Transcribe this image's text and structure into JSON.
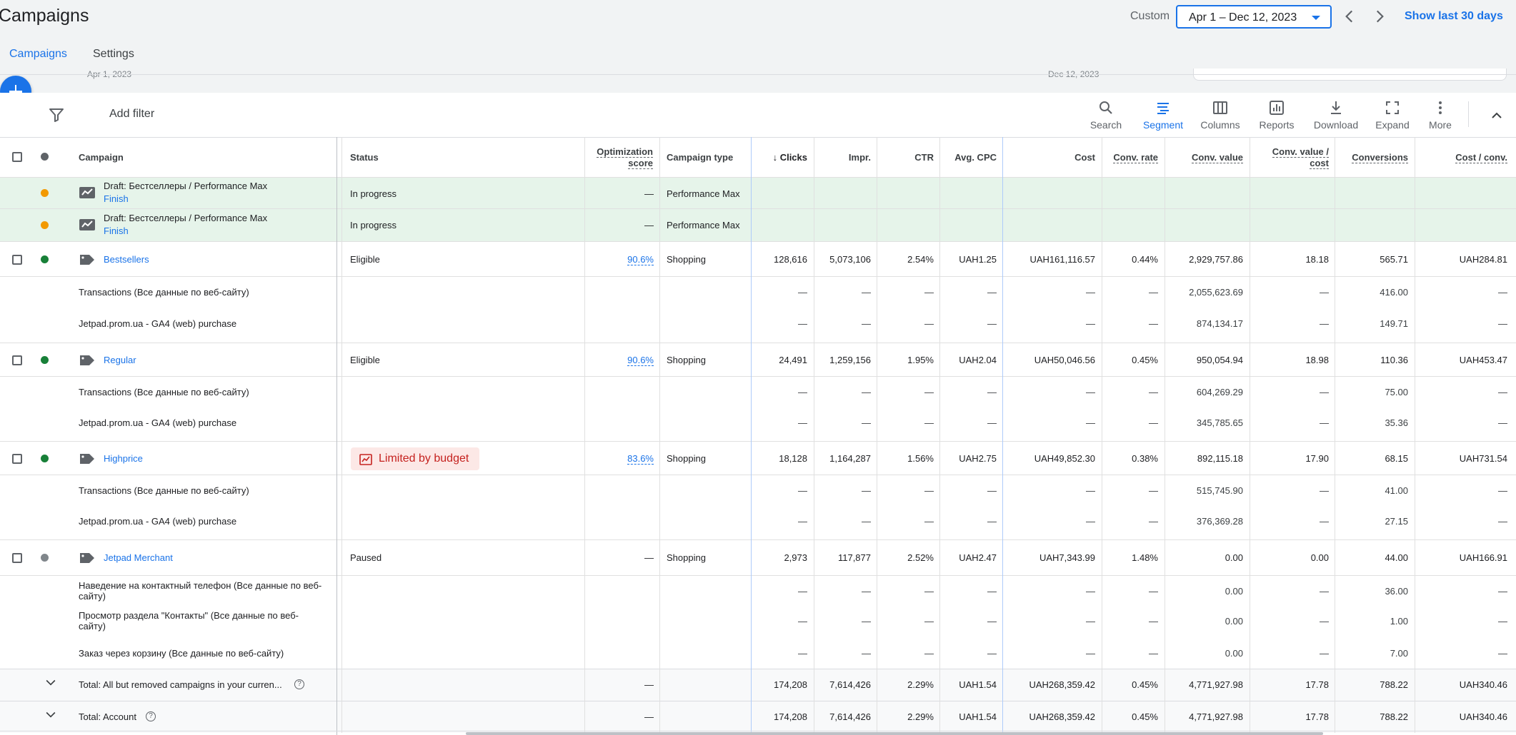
{
  "header": {
    "title": "Campaigns",
    "date_label": "Custom",
    "date_range": "Apr 1 – Dec 12, 2023",
    "show_last": "Show last 30 days"
  },
  "tabs": [
    {
      "label": "Campaigns"
    },
    {
      "label": "Settings"
    }
  ],
  "peek": {
    "start": "Apr 1, 2023",
    "end": "Dec 12, 2023"
  },
  "toolbar": {
    "add_filter": "Add filter",
    "buttons": [
      {
        "label": "Search",
        "icon": "search-icon"
      },
      {
        "label": "Segment",
        "icon": "segment-icon"
      },
      {
        "label": "Columns",
        "icon": "columns-icon"
      },
      {
        "label": "Reports",
        "icon": "reports-icon"
      },
      {
        "label": "Download",
        "icon": "download-icon"
      },
      {
        "label": "Expand",
        "icon": "expand-icon"
      },
      {
        "label": "More",
        "icon": "more-vert-icon"
      }
    ]
  },
  "columns": {
    "campaign": "Campaign",
    "status": "Status",
    "opt1": "Optimization",
    "opt2": "score",
    "type": "Campaign type",
    "clicks": "Clicks",
    "impr": "Impr.",
    "ctr": "CTR",
    "cpc": "Avg. CPC",
    "cost": "Cost",
    "convrate": "Conv. rate",
    "convvalue": "Conv. value",
    "vc1": "Conv. value /",
    "vc2": "cost",
    "conversions": "Conversions",
    "costconv": "Cost / conv."
  },
  "drafts": [
    {
      "name": "Draft: Бестселлеры / Performance Max",
      "action": "Finish",
      "status": "In progress",
      "opt": "—",
      "type": "Performance Max"
    },
    {
      "name": "Draft: Бестселлеры / Performance Max",
      "action": "Finish",
      "status": "In progress",
      "opt": "—",
      "type": "Performance Max"
    }
  ],
  "campaigns": [
    {
      "name": "Bestsellers",
      "status": "Eligible",
      "opt": "90.6%",
      "type": "Shopping",
      "clicks": "128,616",
      "impr": "5,073,106",
      "ctr": "2.54%",
      "cpc": "UAH1.25",
      "cost": "UAH161,116.57",
      "convrate": "0.44%",
      "convvalue": "2,929,757.86",
      "valuecost": "18.18",
      "conversions": "565.71",
      "costconv": "UAH284.81",
      "subs": [
        {
          "name": "Transactions (Все данные по веб-сайту)",
          "convvalue": "2,055,623.69",
          "conversions": "416.00"
        },
        {
          "name": "Jetpad.prom.ua - GA4 (web) purchase",
          "convvalue": "874,134.17",
          "conversions": "149.71"
        }
      ]
    },
    {
      "name": "Regular",
      "status": "Eligible",
      "opt": "90.6%",
      "type": "Shopping",
      "clicks": "24,491",
      "impr": "1,259,156",
      "ctr": "1.95%",
      "cpc": "UAH2.04",
      "cost": "UAH50,046.56",
      "convrate": "0.45%",
      "convvalue": "950,054.94",
      "valuecost": "18.98",
      "conversions": "110.36",
      "costconv": "UAH453.47",
      "subs": [
        {
          "name": "Transactions (Все данные по веб-сайту)",
          "convvalue": "604,269.29",
          "conversions": "75.00"
        },
        {
          "name": "Jetpad.prom.ua - GA4 (web) purchase",
          "convvalue": "345,785.65",
          "conversions": "35.36"
        }
      ]
    },
    {
      "name": "Highprice",
      "status": "Limited by budget",
      "opt": "83.6%",
      "type": "Shopping",
      "clicks": "18,128",
      "impr": "1,164,287",
      "ctr": "1.56%",
      "cpc": "UAH2.75",
      "cost": "UAH49,852.30",
      "convrate": "0.38%",
      "convvalue": "892,115.18",
      "valuecost": "17.90",
      "conversions": "68.15",
      "costconv": "UAH731.54",
      "subs": [
        {
          "name": "Transactions (Все данные по веб-сайту)",
          "convvalue": "515,745.90",
          "conversions": "41.00"
        },
        {
          "name": "Jetpad.prom.ua - GA4 (web) purchase",
          "convvalue": "376,369.28",
          "conversions": "27.15"
        }
      ]
    },
    {
      "name": "Jetpad Merchant",
      "status": "Paused",
      "opt": "—",
      "type": "Shopping",
      "clicks": "2,973",
      "impr": "117,877",
      "ctr": "2.52%",
      "cpc": "UAH2.47",
      "cost": "UAH7,343.99",
      "convrate": "1.48%",
      "convvalue": "0.00",
      "valuecost": "0.00",
      "conversions": "44.00",
      "costconv": "UAH166.91",
      "subs": [
        {
          "name1": "Наведение на контактный телефон (Все данные по веб-",
          "name2": "сайту)",
          "convvalue": "0.00",
          "conversions": "36.00"
        },
        {
          "name1": "Просмотр раздела \"Контакты\" (Все данные по веб-",
          "name2": "сайту)",
          "convvalue": "0.00",
          "conversions": "1.00"
        },
        {
          "name": "Заказ через корзину (Все данные по веб-сайту)",
          "convvalue": "0.00",
          "conversions": "7.00"
        }
      ]
    }
  ],
  "dash": "—",
  "totals": [
    {
      "label": "Total: All but removed campaigns in your curren...",
      "opt": "—",
      "clicks": "174,208",
      "impr": "7,614,426",
      "ctr": "2.29%",
      "cpc": "UAH1.54",
      "cost": "UAH268,359.42",
      "convrate": "0.45%",
      "convvalue": "4,771,927.98",
      "valuecost": "17.78",
      "conversions": "788.22",
      "costconv": "UAH340.46"
    },
    {
      "label": "Total: Account",
      "opt": "—",
      "clicks": "174,208",
      "impr": "7,614,426",
      "ctr": "2.29%",
      "cpc": "UAH1.54",
      "cost": "UAH268,359.42",
      "convrate": "0.45%",
      "convvalue": "4,771,927.98",
      "valuecost": "17.78",
      "conversions": "788.22",
      "costconv": "UAH340.46"
    }
  ],
  "colors": {
    "accent": "#1a73e8",
    "eligible": "#188038",
    "draft_bg": "#e6f4ea",
    "draft_dot": "#f29900",
    "limited_bg": "#fce8e6",
    "limited_text": "#c5221f"
  }
}
